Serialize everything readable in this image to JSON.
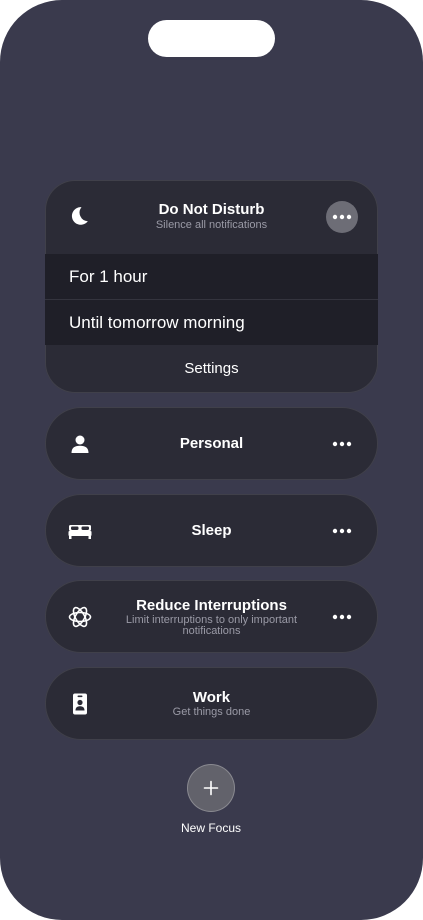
{
  "dnd": {
    "title": "Do Not Disturb",
    "subtitle": "Silence all notifications",
    "icon": "moon-icon",
    "options": [
      "For 1 hour",
      "Until tomorrow morning"
    ],
    "settings_label": "Settings"
  },
  "focus_modes": [
    {
      "name": "Personal",
      "subtitle": "",
      "icon": "person-icon"
    },
    {
      "name": "Sleep",
      "subtitle": "",
      "icon": "bed-icon"
    },
    {
      "name": "Reduce Interruptions",
      "subtitle": "Limit interruptions to only important notifications",
      "icon": "reduce-interruptions-icon"
    },
    {
      "name": "Work",
      "subtitle": "Get things done",
      "icon": "id-badge-icon"
    }
  ],
  "new_focus": {
    "label": "New Focus",
    "icon": "plus-icon"
  },
  "colors": {
    "background": "#3a3a4d",
    "card": "#2b2b36",
    "options_band": "#1f1f28",
    "secondary_text": "#9a9aa6"
  }
}
